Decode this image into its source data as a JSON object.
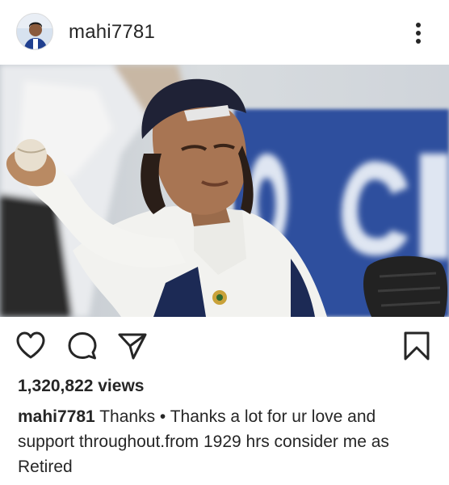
{
  "post": {
    "username": "mahi7781",
    "views": "1,320,822 views",
    "caption_user": "mahi7781",
    "caption_text": "Thanks • Thanks a lot for ur love and support throughout.from 1929 hrs consider me as Retired"
  },
  "icons": {
    "avatar": "profile-photo",
    "more": "more-options-icon",
    "like": "heart-icon",
    "comment": "comment-icon",
    "share": "send-icon",
    "save": "bookmark-icon"
  },
  "colors": {
    "text": "#262626",
    "background": "#ffffff",
    "photo_banner": "#2f4f9e"
  }
}
